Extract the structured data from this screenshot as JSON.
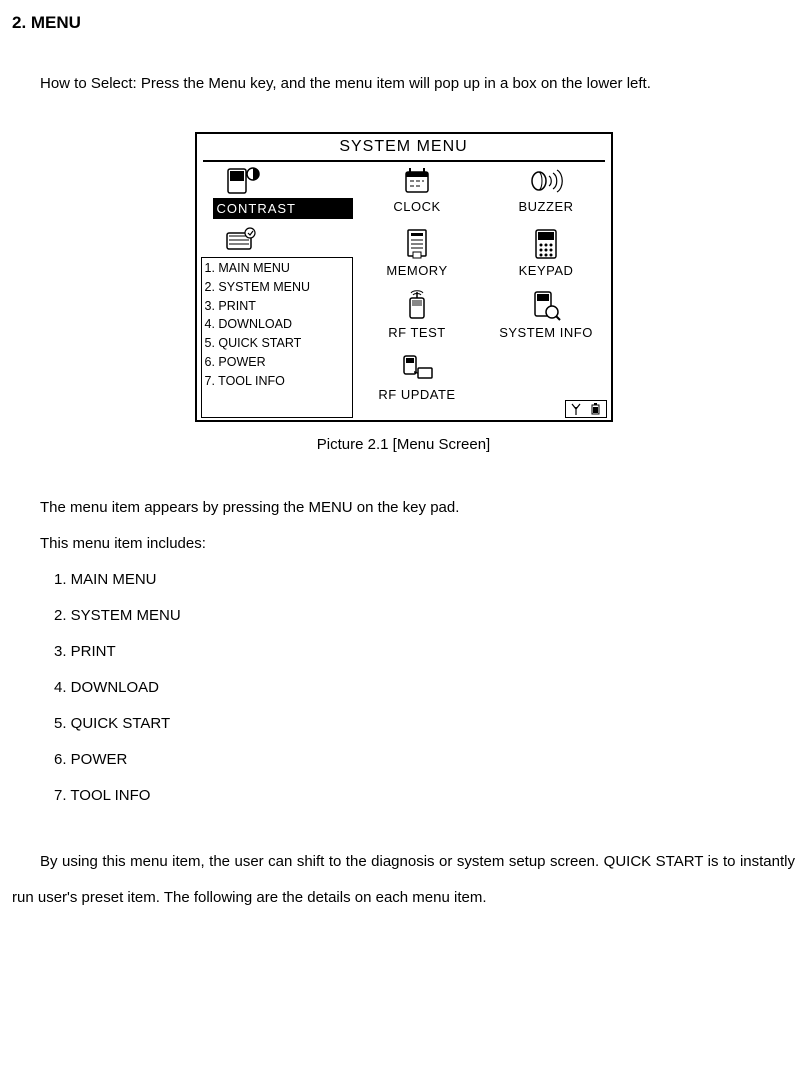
{
  "heading": "2. MENU",
  "intro": "How to Select: Press the Menu key, and the menu item will pop up in a box on the lower left.",
  "screen": {
    "title": "SYSTEM MENU",
    "selected": "CONTRAST",
    "popup": [
      "1. MAIN MENU",
      "2. SYSTEM MENU",
      "3. PRINT",
      "4. DOWNLOAD",
      "5. QUICK START",
      "6. POWER",
      "7. TOOL INFO"
    ],
    "grid": {
      "clock": "CLOCK",
      "buzzer": "BUZZER",
      "memory": "MEMORY",
      "keypad": "KEYPAD",
      "rftest": "RF TEST",
      "sysinfo": "SYSTEM INFO",
      "rfupdate": "RF UPDATE"
    }
  },
  "caption": "Picture 2.1 [Menu Screen]",
  "line1": "The menu item appears by pressing the MENU on the key pad.",
  "line2": "This menu item includes:",
  "items": [
    "1. MAIN MENU",
    "2. SYSTEM MENU",
    "3. PRINT",
    "4. DOWNLOAD",
    "5. QUICK START",
    "6. POWER",
    "7. TOOL INFO"
  ],
  "closing": "By using this menu item, the user can shift to the diagnosis or system setup screen. QUICK START is to instantly run user's preset item. The following are the details on each menu item."
}
